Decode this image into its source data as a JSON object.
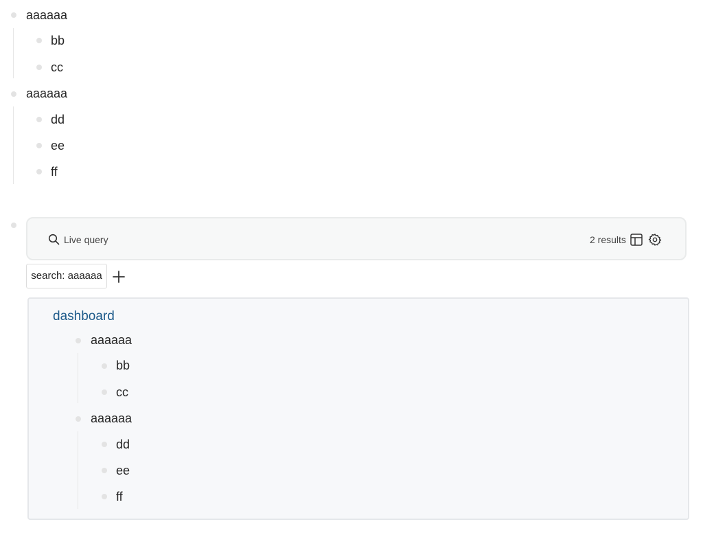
{
  "outline": {
    "blocks": [
      {
        "label": "aaaaaa",
        "children": [
          "bb",
          "cc"
        ]
      },
      {
        "label": "aaaaaa",
        "children": [
          "dd",
          "ee",
          "ff"
        ]
      }
    ]
  },
  "query": {
    "label": "Live query",
    "results_count": "2 results",
    "icons": [
      "search-icon",
      "table-view-icon",
      "settings-gear-icon",
      "add-plus-icon"
    ],
    "filter_chip": "search: aaaaaa"
  },
  "results": {
    "page_link": "dashboard",
    "blocks": [
      {
        "label": "aaaaaa",
        "children": [
          "bb",
          "cc"
        ]
      },
      {
        "label": "aaaaaa",
        "children": [
          "dd",
          "ee",
          "ff"
        ]
      }
    ]
  },
  "colors": {
    "link": "#1d5a8a",
    "bullet": "#e3e3e3",
    "panel_bg": "#f7f8fa",
    "text": "#262626"
  }
}
